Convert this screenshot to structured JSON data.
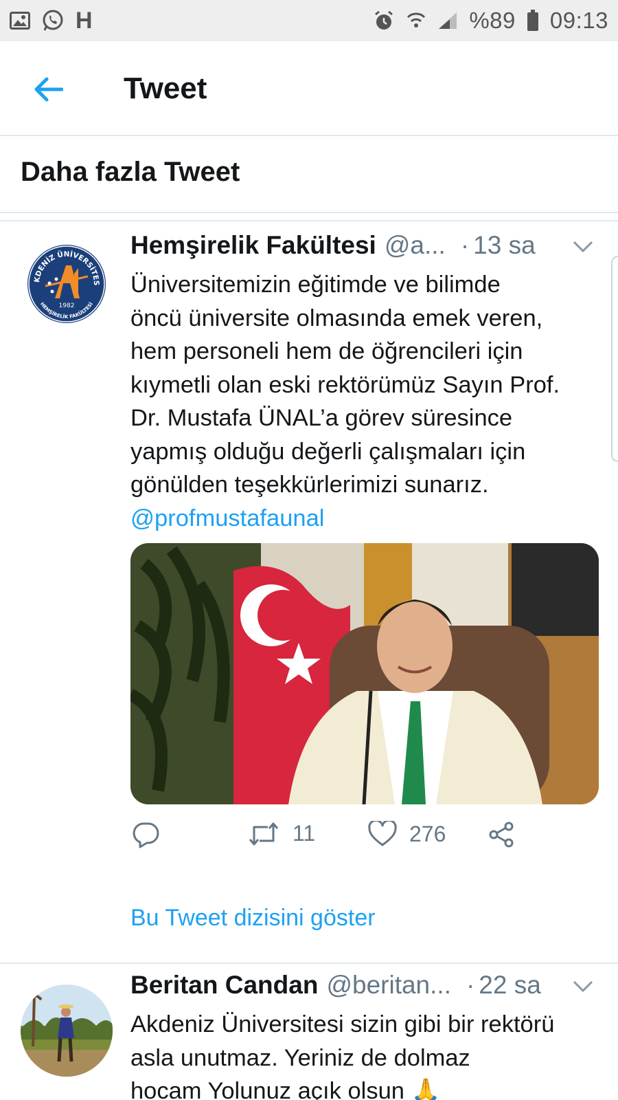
{
  "status_bar": {
    "battery": "%89",
    "time": "09:13",
    "letter": "H"
  },
  "app_bar": {
    "title": "Tweet"
  },
  "section": {
    "title": "Daha fazla Tweet"
  },
  "tweets": [
    {
      "name": "Hemşirelik Fakültesi",
      "handle": "@a...",
      "dot": "·",
      "time": "13 sa",
      "text": "Üniversitemizin eğitimde ve bilimde\nöncü üniversite olmasında emek veren,\nhem personeli hem de öğrencileri için\nkıymetli olan eski rektörümüz Sayın Prof.\nDr. Mustafa ÜNAL’a görev süresince\nyapmış olduğu değerli çalışmaları için\ngönülden teşekkürlerimizi sunarız.",
      "mention": "@profmustafaunal",
      "avatar_logo": {
        "top_text": "AKDENİZ ÜNİVERSİTESİ",
        "bottom_text": "HEMŞİRELİK FAKÜLTESİ",
        "year": "1982"
      },
      "retweets": "11",
      "likes": "276",
      "thread_link": "Bu Tweet dizisini göster"
    },
    {
      "name": "Beritan Candan",
      "handle": "@beritan...",
      "dot": "·",
      "time": "22 sa",
      "text": "Akdeniz Üniversitesi sizin gibi bir rektörü\nasla unutmaz. Yeriniz de dolmaz\nhocam Yolunuz açık olsun 🙏"
    }
  ],
  "colors": {
    "accent": "#1da1f2",
    "text": "#14171a",
    "secondary": "#657786",
    "divider": "#e1e8ed",
    "status_bg": "#eeeeee"
  }
}
